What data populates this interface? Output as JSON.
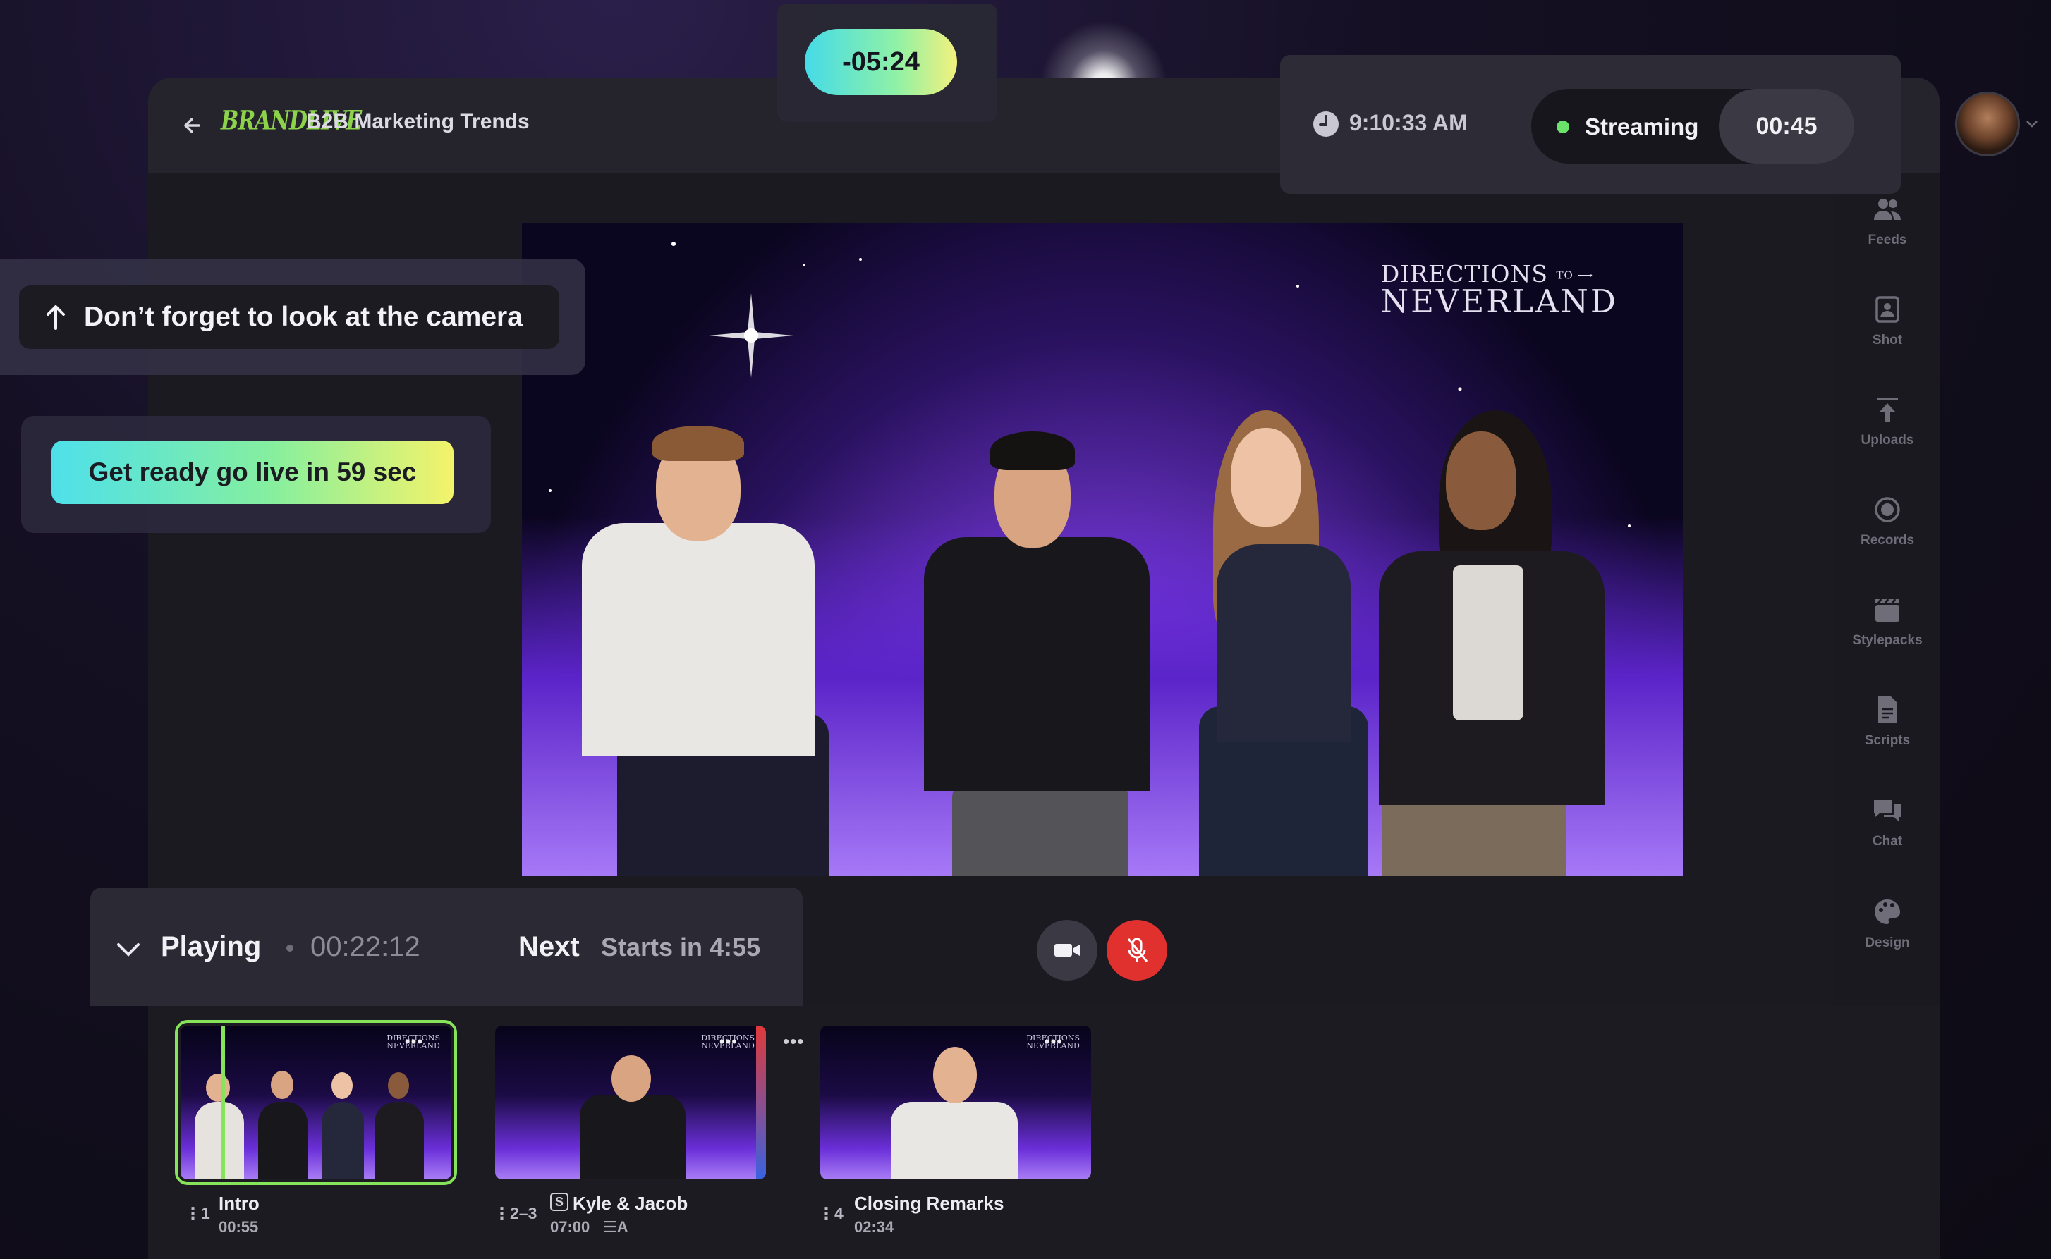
{
  "header": {
    "logo_text": "BRANDLIVE",
    "title": "B2B Marketing Trends"
  },
  "countdown": {
    "value": "-05:24"
  },
  "status": {
    "clock_time": "9:10:33 AM",
    "stream_label": "Streaming",
    "stream_elapsed": "00:45",
    "stream_status_color": "#6be36b"
  },
  "reminder": {
    "text": "Don’t forget to look at the camera"
  },
  "golive": {
    "text": "Get ready go live in 59 sec"
  },
  "video": {
    "watermark_line1": "DIRECTIONS",
    "watermark_to": "TO",
    "watermark_line2": "NEVERLAND"
  },
  "playbar": {
    "state": "Playing",
    "elapsed": "00:22:12",
    "next_label": "Next",
    "next_starts": "Starts in 4:55"
  },
  "controls": {
    "camera": "camera-icon",
    "mic": "mic-muted-icon",
    "mic_color": "#e0312f"
  },
  "segments": [
    {
      "number": "1",
      "name": "Intro",
      "duration": "00:55",
      "active": true
    },
    {
      "number": "2–3",
      "name": "Kyle & Jacob",
      "duration": "07:00",
      "active": false
    },
    {
      "number": "4",
      "name": "Closing Remarks",
      "duration": "02:34",
      "active": false
    }
  ],
  "sidebar": {
    "items": [
      {
        "label": "Feeds",
        "icon": "people-icon"
      },
      {
        "label": "Shot",
        "icon": "shot-icon"
      },
      {
        "label": "Uploads",
        "icon": "upload-icon"
      },
      {
        "label": "Records",
        "icon": "record-icon"
      },
      {
        "label": "Stylepacks",
        "icon": "clapper-icon"
      },
      {
        "label": "Scripts",
        "icon": "document-icon"
      },
      {
        "label": "Chat",
        "icon": "chat-icon"
      },
      {
        "label": "Design",
        "icon": "palette-icon"
      }
    ]
  },
  "colors": {
    "accent_green": "#86e35a",
    "gradient_start": "#4ee0ea",
    "gradient_end": "#f4f36a"
  }
}
